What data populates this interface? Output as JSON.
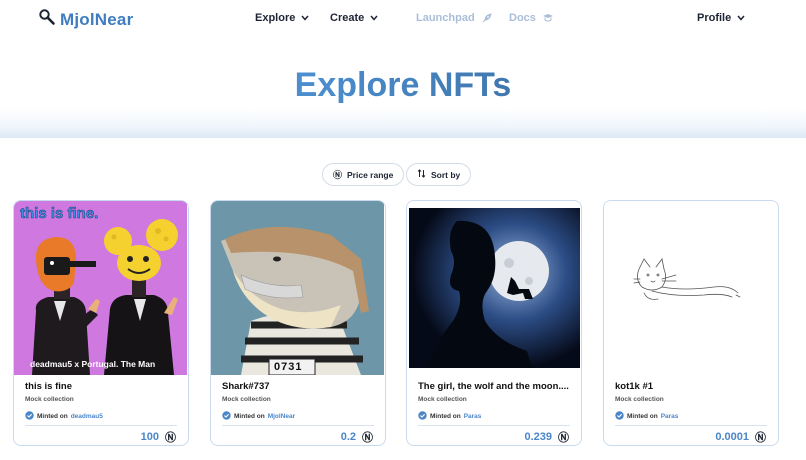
{
  "brand": {
    "name": "MjolNear",
    "logo_icon": "hammer-icon"
  },
  "nav": {
    "explore": "Explore",
    "create": "Create",
    "launchpad": "Launchpad",
    "docs": "Docs",
    "profile": "Profile"
  },
  "hero": {
    "title": "Explore NFTs"
  },
  "filters": {
    "price_range": "Price range",
    "sort_by": "Sort by"
  },
  "currency_symbol": "Ⓝ",
  "cards": [
    {
      "name": "this is fine",
      "collection": "Mock collection",
      "minted_prefix": "Minted on",
      "minted_by": "deadmau5",
      "price": "100",
      "image_text_top": "this is fine.",
      "image_text_bottom": "deadmau5 x Portugal. The Man"
    },
    {
      "name": "Shark#737",
      "collection": "Mock collection",
      "minted_prefix": "Minted on",
      "minted_by": "MjolNear",
      "price": "0.2",
      "image_text_badge": "0731"
    },
    {
      "name": "The girl, the wolf and the moon....",
      "collection": "Mock collection",
      "minted_prefix": "Minted on",
      "minted_by": "Paras",
      "price": "0.239"
    },
    {
      "name": "kot1k #1",
      "collection": "Mock collection",
      "minted_prefix": "Minted on",
      "minted_by": "Paras",
      "price": "0.0001"
    }
  ],
  "colors": {
    "accent": "#4a86c8",
    "card_border": "#c9daee",
    "pink_bg": "#cf79e0",
    "shark_bg": "#6d96a8",
    "moon_bg": "#0a1428"
  }
}
